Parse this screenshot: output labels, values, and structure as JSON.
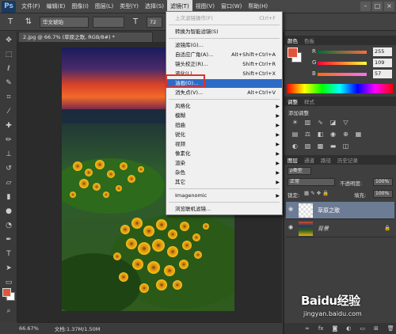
{
  "app": {
    "logo": "Ps"
  },
  "menubar": {
    "items": [
      "文件(F)",
      "编辑(E)",
      "图像(I)",
      "图层(L)",
      "类型(Y)",
      "选择(S)",
      "滤镜(T)",
      "视图(V)",
      "窗口(W)",
      "帮助(H)"
    ],
    "active_index": 6,
    "window_controls": [
      "–",
      "□",
      "×"
    ]
  },
  "options_bar": {
    "tool_icon": "T",
    "font_family": "华文琥珀",
    "font_size": "72"
  },
  "document_tab": {
    "title": "2.jpg @ 66.7% (草原之歌, RGB/8#) *"
  },
  "status_bar": {
    "zoom": "66.67%",
    "doc_info": "文档:1.37M/1.50M"
  },
  "filter_menu": {
    "items": [
      {
        "label": "上次滤镜操作(F)",
        "shortcut": "Ctrl+F",
        "disabled": true,
        "submenu": false
      },
      {
        "label": "转换为智能滤镜(S)",
        "shortcut": "",
        "disabled": false,
        "submenu": false
      },
      {
        "label": "滤镜库(G)...",
        "shortcut": "",
        "disabled": false,
        "submenu": false
      },
      {
        "label": "自适应广角(A)...",
        "shortcut": "Alt+Shift+Ctrl+A",
        "disabled": false,
        "submenu": false
      },
      {
        "label": "镜头校正(R)...",
        "shortcut": "Shift+Ctrl+R",
        "disabled": false,
        "submenu": false
      },
      {
        "label": "液化(L)...",
        "shortcut": "Shift+Ctrl+X",
        "disabled": false,
        "submenu": false
      },
      {
        "label": "油画(O)...",
        "shortcut": "",
        "disabled": false,
        "submenu": false
      },
      {
        "label": "消失点(V)...",
        "shortcut": "Alt+Ctrl+V",
        "disabled": false,
        "submenu": false
      },
      {
        "label": "风格化",
        "shortcut": "",
        "disabled": false,
        "submenu": true
      },
      {
        "label": "模糊",
        "shortcut": "",
        "disabled": false,
        "submenu": true
      },
      {
        "label": "扭曲",
        "shortcut": "",
        "disabled": false,
        "submenu": true
      },
      {
        "label": "锐化",
        "shortcut": "",
        "disabled": false,
        "submenu": true
      },
      {
        "label": "视频",
        "shortcut": "",
        "disabled": false,
        "submenu": true
      },
      {
        "label": "像素化",
        "shortcut": "",
        "disabled": false,
        "submenu": true
      },
      {
        "label": "渲染",
        "shortcut": "",
        "disabled": false,
        "submenu": true
      },
      {
        "label": "杂色",
        "shortcut": "",
        "disabled": false,
        "submenu": true
      },
      {
        "label": "其它",
        "shortcut": "",
        "disabled": false,
        "submenu": true
      },
      {
        "label": "Imagenomic",
        "shortcut": "",
        "disabled": false,
        "submenu": true
      },
      {
        "label": "浏览联机滤镜...",
        "shortcut": "",
        "disabled": false,
        "submenu": false
      }
    ],
    "highlighted_index": 6
  },
  "color_panel": {
    "tabs": [
      "颜色",
      "色板"
    ],
    "channels": [
      {
        "label": "R",
        "value": "255"
      },
      {
        "label": "G",
        "value": "109"
      },
      {
        "label": "B",
        "value": "57"
      }
    ],
    "foreground": "#ff6d39"
  },
  "adjustments_panel": {
    "tabs": [
      "调整",
      "样式"
    ],
    "heading": "添加调整"
  },
  "layers_panel": {
    "tabs": [
      "图层",
      "通道",
      "路径",
      "历史记录"
    ],
    "filter_kind": "ρ类型",
    "blend_mode": "正常",
    "opacity_label": "不透明度:",
    "opacity_value": "100%",
    "lock_label": "锁定:",
    "fill_label": "填充:",
    "fill_value": "100%",
    "layers": [
      {
        "name": "草原之歌",
        "selected": true
      },
      {
        "name": "背景",
        "selected": false
      }
    ]
  },
  "watermark": {
    "brand": "Baidu经验",
    "url": "jingyan.baidu.com"
  }
}
